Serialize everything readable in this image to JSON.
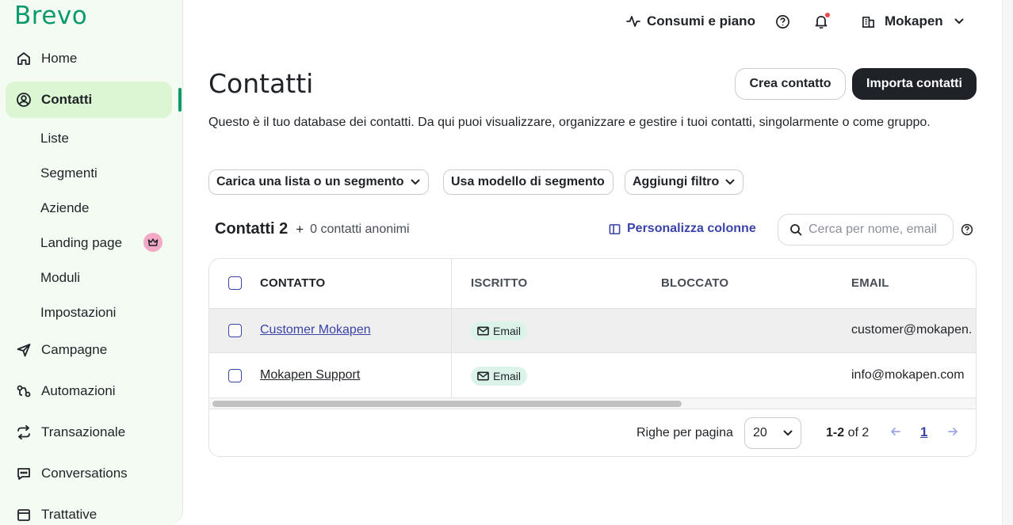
{
  "app": {
    "logo": "Brevo"
  },
  "sidebar": {
    "items": [
      {
        "label": "Home",
        "icon": "home-icon"
      },
      {
        "label": "Contatti",
        "icon": "contacts-icon",
        "active": true
      },
      {
        "label": "Campagne",
        "icon": "send-icon"
      },
      {
        "label": "Automazioni",
        "icon": "automation-icon"
      },
      {
        "label": "Transazionale",
        "icon": "transactional-icon"
      },
      {
        "label": "Conversations",
        "icon": "chat-icon"
      },
      {
        "label": "Trattative",
        "icon": "deals-icon"
      }
    ],
    "sub_items": [
      "Liste",
      "Segmenti",
      "Aziende",
      "Landing page",
      "Moduli",
      "Impostazioni"
    ],
    "premium_icon": "crown-icon",
    "colors": {
      "bg": "#f4fbf2",
      "active_bg": "#dcf6d3",
      "accent": "#0b996e"
    }
  },
  "topbar": {
    "usage_label": "Consumi e piano",
    "usage_icon": "activity-icon",
    "help_icon": "help-icon",
    "notifications_icon": "bell-icon",
    "account_label": "Mokapen",
    "account_icon": "building-icon"
  },
  "header": {
    "title": "Contatti",
    "create_label": "Crea contatto",
    "import_label": "Importa contatti",
    "description": "Questo è il tuo database dei contatti. Da qui puoi visualizzare, organizzare e gestire i tuoi contatti, singolarmente o come gruppo."
  },
  "filters": {
    "load_list": "Carica una lista o un segmento",
    "segment_template": "Usa modello di segmento",
    "add_filter": "Aggiungi filtro"
  },
  "summary": {
    "count_label": "Contatti 2",
    "plus": "+",
    "anonymous": "0 contatti anonimi",
    "customize_columns": "Personalizza colonne",
    "search_placeholder": "Cerca per nome, email"
  },
  "table": {
    "columns": [
      "CONTATTO",
      "ISCRITTO",
      "BLOCCATO",
      "EMAIL"
    ],
    "rows": [
      {
        "name": "Customer Mokapen",
        "subscribed": "Email",
        "blocked": "",
        "email": "customer@mokapen.",
        "highlighted": true
      },
      {
        "name": "Mokapen Support",
        "subscribed": "Email",
        "blocked": "",
        "email": "info@mokapen.com",
        "highlighted": false
      }
    ]
  },
  "pagination": {
    "rows_per_page_label": "Righe per pagina",
    "rows_per_page": "20",
    "range_bold": "1-2",
    "range_rest": "of 2",
    "current_page": "1"
  },
  "colors": {
    "primary_dark": "#1f2328",
    "link_blue": "#3a43a8",
    "badge_bg": "#dcf3ea"
  }
}
